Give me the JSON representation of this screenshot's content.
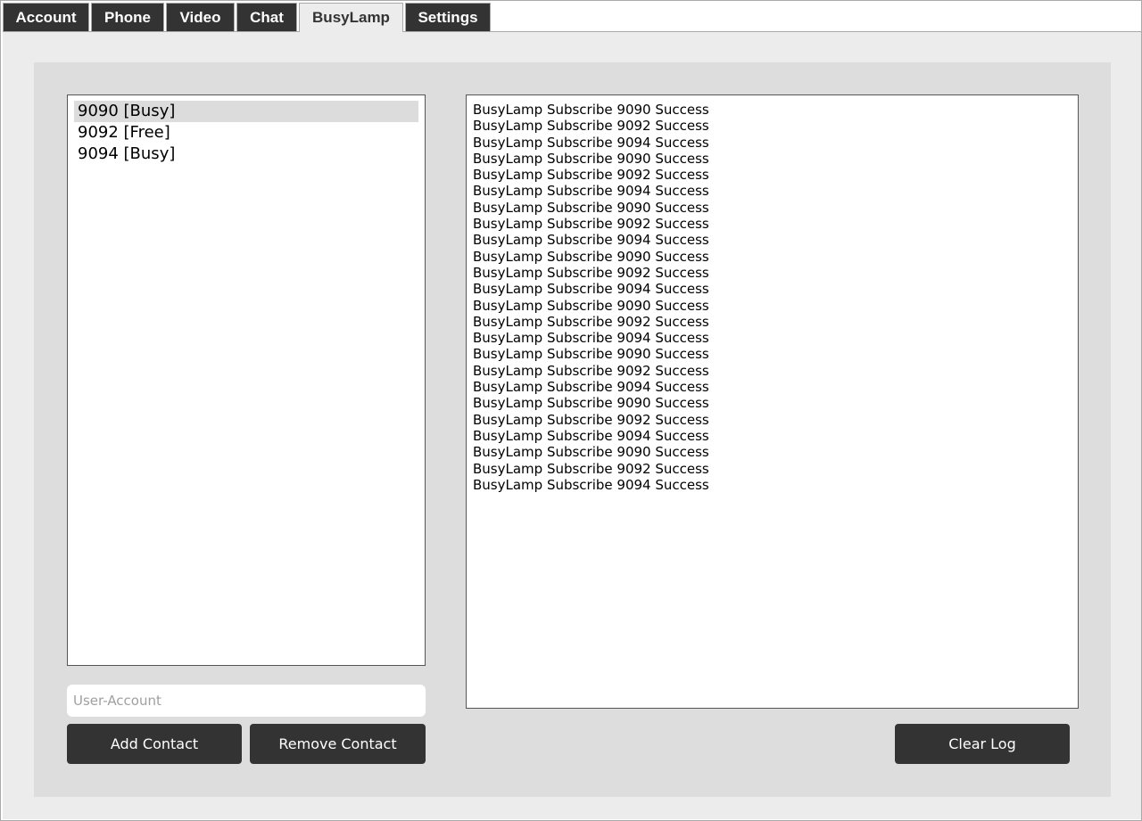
{
  "tabs": [
    {
      "label": "Account",
      "active": false
    },
    {
      "label": "Phone",
      "active": false
    },
    {
      "label": "Video",
      "active": false
    },
    {
      "label": "Chat",
      "active": false
    },
    {
      "label": "BusyLamp",
      "active": true
    },
    {
      "label": "Settings",
      "active": false
    }
  ],
  "contacts": [
    {
      "label": "9090 [Busy]",
      "selected": true
    },
    {
      "label": "9092 [Free]",
      "selected": false
    },
    {
      "label": "9094 [Busy]",
      "selected": false
    }
  ],
  "log": [
    "BusyLamp Subscribe 9090 Success",
    "BusyLamp Subscribe 9092 Success",
    "BusyLamp Subscribe 9094 Success",
    "BusyLamp Subscribe 9090 Success",
    "BusyLamp Subscribe 9092 Success",
    "BusyLamp Subscribe 9094 Success",
    "BusyLamp Subscribe 9090 Success",
    "BusyLamp Subscribe 9092 Success",
    "BusyLamp Subscribe 9094 Success",
    "BusyLamp Subscribe 9090 Success",
    "BusyLamp Subscribe 9092 Success",
    "BusyLamp Subscribe 9094 Success",
    "BusyLamp Subscribe 9090 Success",
    "BusyLamp Subscribe 9092 Success",
    "BusyLamp Subscribe 9094 Success",
    "BusyLamp Subscribe 9090 Success",
    "BusyLamp Subscribe 9092 Success",
    "BusyLamp Subscribe 9094 Success",
    "BusyLamp Subscribe 9090 Success",
    "BusyLamp Subscribe 9092 Success",
    "BusyLamp Subscribe 9094 Success",
    "BusyLamp Subscribe 9090 Success",
    "BusyLamp Subscribe 9092 Success",
    "BusyLamp Subscribe 9094 Success"
  ],
  "user_input": {
    "placeholder": "User-Account",
    "value": ""
  },
  "buttons": {
    "add_contact": "Add Contact",
    "remove_contact": "Remove Contact",
    "clear_log": "Clear Log"
  },
  "colors": {
    "tab_dark": "#333333",
    "tab_active": "#ececec",
    "panel_bg": "#dddddd",
    "page_bg": "#ececec",
    "selected_row": "#dcdcdc"
  }
}
